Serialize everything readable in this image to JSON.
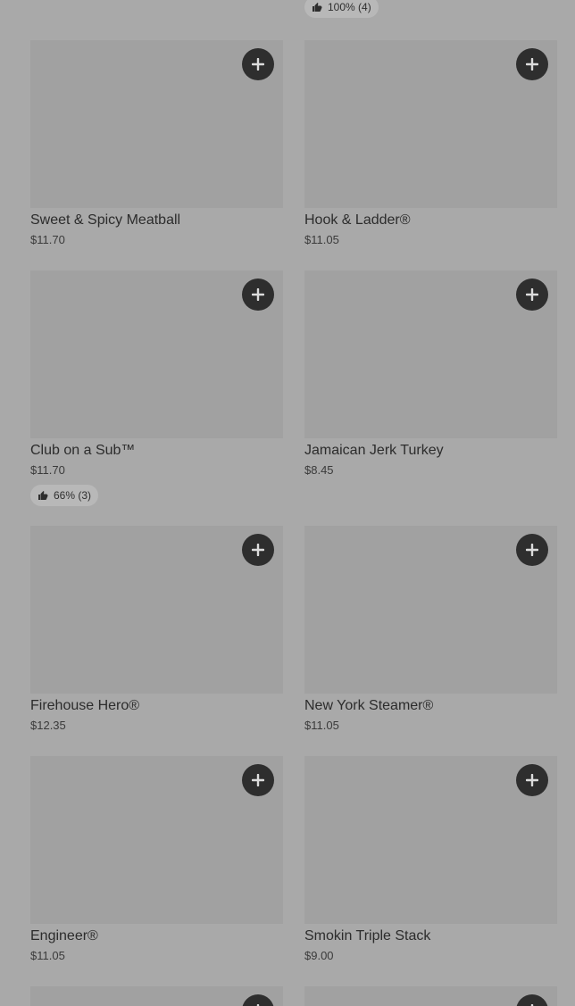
{
  "top_rating": {
    "text": "100% (4)"
  },
  "items": [
    {
      "name": "Sweet & Spicy Meatball",
      "price": "$11.70",
      "rating": null
    },
    {
      "name": "Hook & Ladder®",
      "price": "$11.05",
      "rating": null
    },
    {
      "name": "Club on a Sub™",
      "price": "$11.70",
      "rating": "66% (3)"
    },
    {
      "name": "Jamaican Jerk Turkey",
      "price": "$8.45",
      "rating": null
    },
    {
      "name": "Firehouse Hero®",
      "price": "$12.35",
      "rating": null
    },
    {
      "name": "New York Steamer®",
      "price": "$11.05",
      "rating": null
    },
    {
      "name": "Engineer®",
      "price": "$11.05",
      "rating": null
    },
    {
      "name": "Smokin Triple Stack",
      "price": "$9.00",
      "rating": null
    }
  ],
  "icons": {
    "add": "plus-icon",
    "rating": "thumbs-up-icon"
  },
  "colors": {
    "button_bg": "#2e2e2e",
    "image_placeholder": "#a1a1a1",
    "background": "#a9a9a9"
  }
}
